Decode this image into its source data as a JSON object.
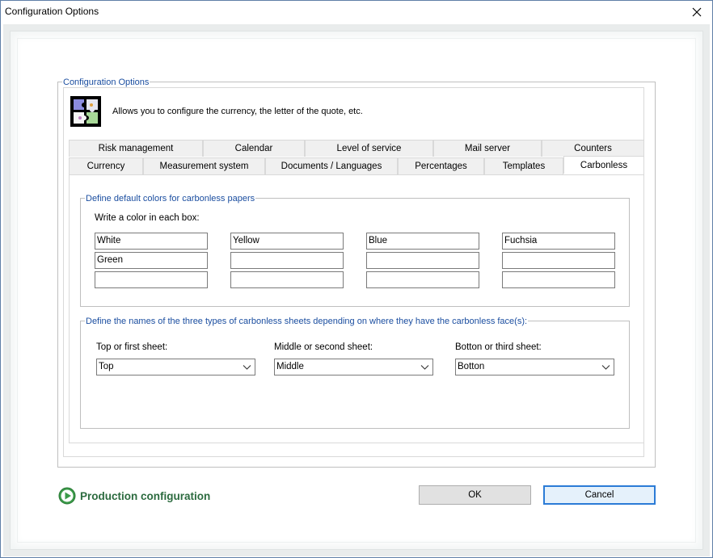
{
  "window": {
    "title": "Configuration Options"
  },
  "group": {
    "label": "Configuration Options",
    "description": "Allows you to configure the currency, the letter of the quote, etc."
  },
  "tabs": {
    "row_top": [
      "Risk management",
      "Calendar",
      "Level of service",
      "Mail server",
      "Counters"
    ],
    "row_bottom": [
      "Currency",
      "Measurement system",
      "Documents / Languages",
      "Percentages",
      "Templates"
    ],
    "active": "Carbonless"
  },
  "colors_section": {
    "legend": "Define default colors for carbonless papers",
    "instruction": "Write a color in each box:",
    "grid": [
      [
        "White",
        "Yellow",
        "Blue",
        "Fuchsia"
      ],
      [
        "Green",
        "",
        "",
        ""
      ],
      [
        "",
        "",
        "",
        ""
      ]
    ]
  },
  "sheets_section": {
    "legend": "Define the names of the three types of carbonless sheets depending on where they have the carbonless face(s):",
    "top": {
      "label": "Top or first sheet:",
      "value": "Top"
    },
    "middle": {
      "label": "Middle or second sheet:",
      "value": "Middle"
    },
    "bottom": {
      "label": "Botton or third sheet:",
      "value": "Botton"
    }
  },
  "footer": {
    "production": "Production configuration",
    "ok": "OK",
    "cancel": "Cancel"
  },
  "icons": {
    "close": "close-icon",
    "chevron": "chevron-down-icon",
    "play": "play-circle-icon",
    "app": "puzzle-pieces-icon"
  },
  "colors": {
    "accent_text": "#1b4ea0",
    "production_text": "#2c6b3f",
    "play_green": "#3a9a48",
    "default_button_border": "#2b7bd6"
  }
}
